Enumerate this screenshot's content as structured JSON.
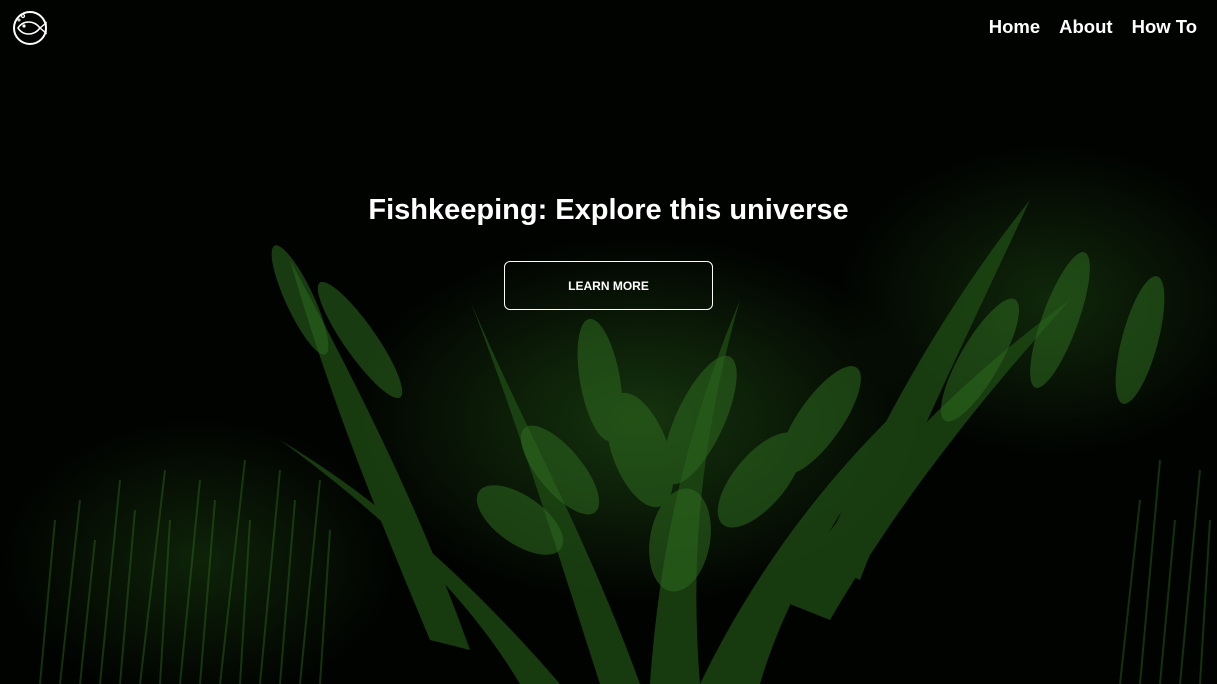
{
  "nav": {
    "logo_icon": "fish-icon",
    "links": [
      {
        "label": "Home"
      },
      {
        "label": "About"
      },
      {
        "label": "How To"
      }
    ]
  },
  "hero": {
    "title": "Fishkeeping: Explore this universe",
    "button_label": "LEARN MORE",
    "background": "aquarium-plants-image"
  },
  "colors": {
    "background": "#000000",
    "text": "#ffffff",
    "foliage": "#2f6b1f"
  }
}
